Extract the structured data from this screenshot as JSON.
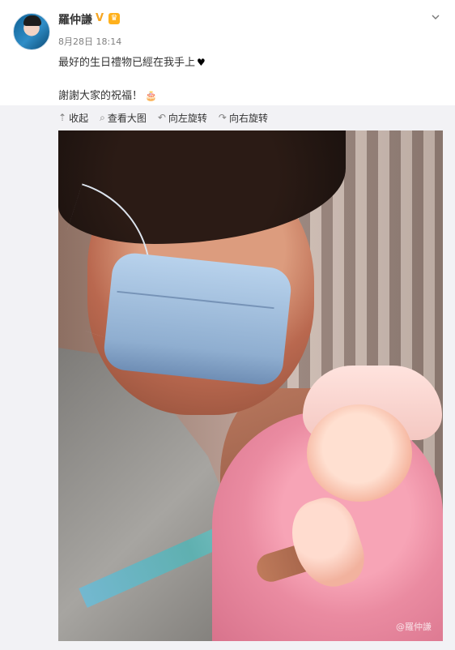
{
  "post": {
    "author": "羅仲謙",
    "time": "8月28日 18:14",
    "text_line1": "最好的生日禮物已經在我手上",
    "text_line2": "謝謝大家的祝福！",
    "heart": "♥",
    "cake": "🎂",
    "verified": "V",
    "crown": "♛"
  },
  "toolbar": {
    "collapse": "收起",
    "view_large": "查看大图",
    "rotate_left": "向左旋转",
    "rotate_right": "向右旋转"
  },
  "image": {
    "watermark": "@羅仲謙"
  }
}
